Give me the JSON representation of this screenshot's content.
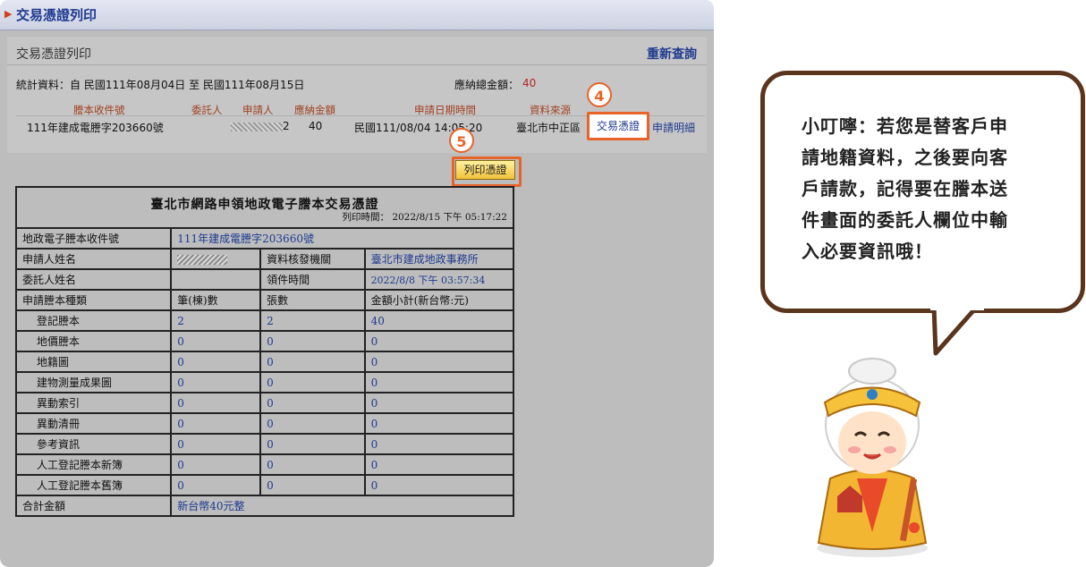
{
  "header": {
    "title": "交易憑證列印"
  },
  "section": {
    "title": "交易憑證列印",
    "requery_label": "重新查詢"
  },
  "stats": {
    "text": "統計資料：自 民國111年08月04日 至 民國111年08月15日",
    "total_label": "應納總金額：",
    "total_value": "40"
  },
  "list": {
    "columns": [
      "謄本收件號",
      "委託人",
      "申請人",
      "應納金額",
      "申請日期時間",
      "資料來源"
    ],
    "row": {
      "receipt_no": "111年建成電謄字203660號",
      "applicant_suffix": "2",
      "amount": "40",
      "datetime": "民國111/08/04 14:05:20",
      "source": "臺北市中正區",
      "voucher_link": "交易憑證",
      "detail_link": "申請明細"
    }
  },
  "steps": {
    "step4": "4",
    "step5": "5"
  },
  "print_button": "列印憑證",
  "receipt": {
    "title": "臺北市網路申領地政電子謄本交易憑證",
    "print_time": "列印時間： 2022/8/15 下午 05:17:22",
    "receipt_no_label": "地政電子謄本收件號",
    "receipt_no": "111年建成電謄字203660號",
    "applicant_label": "申請人姓名",
    "issuer_label": "資料核發機關",
    "issuer": "臺北市建成地政事務所",
    "client_label": "委託人姓名",
    "pickup_label": "領件時間",
    "pickup_time": "2022/8/8 下午 03:57:34",
    "headers": {
      "type": "申請謄本種類",
      "count": "筆(棟)數",
      "sheets": "張數",
      "subtotal": "金額小計(新台幣:元)"
    },
    "rows": [
      {
        "name": "登記謄本",
        "count": "2",
        "sheets": "2",
        "amount": "40"
      },
      {
        "name": "地價謄本",
        "count": "0",
        "sheets": "0",
        "amount": "0"
      },
      {
        "name": "地籍圖",
        "count": "0",
        "sheets": "0",
        "amount": "0"
      },
      {
        "name": "建物測量成果圖",
        "count": "0",
        "sheets": "0",
        "amount": "0"
      },
      {
        "name": "異動索引",
        "count": "0",
        "sheets": "0",
        "amount": "0"
      },
      {
        "name": "異動清冊",
        "count": "0",
        "sheets": "0",
        "amount": "0"
      },
      {
        "name": "參考資訊",
        "count": "0",
        "sheets": "0",
        "amount": "0"
      },
      {
        "name": "人工登記謄本新簿",
        "count": "0",
        "sheets": "0",
        "amount": "0"
      },
      {
        "name": "人工登記謄本舊簿",
        "count": "0",
        "sheets": "0",
        "amount": "0"
      }
    ],
    "total_label": "合計金額",
    "total_value": "新台幣40元整"
  },
  "tip": {
    "lines": [
      "小叮嚀：若您是替客戶申",
      "請地籍資料，之後要向客",
      "戶請款，記得要在謄本送",
      "件畫面的委託人欄位中輸",
      "入必要資訊哦！"
    ]
  },
  "colors": {
    "accent": "#e8632a",
    "link": "#1f3a8f",
    "bubble_border": "#5a341c"
  }
}
